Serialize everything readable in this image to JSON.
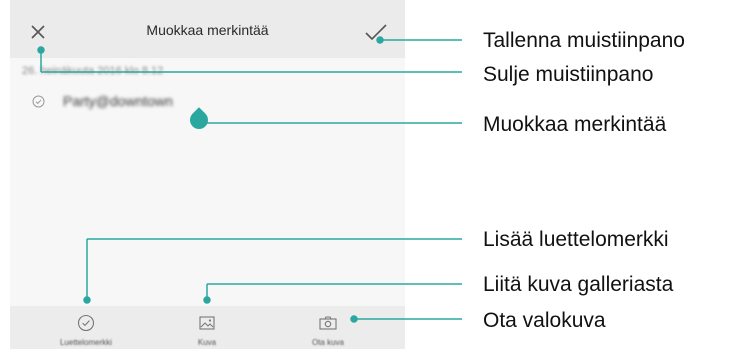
{
  "header": {
    "title": "Muokkaa merkintää",
    "close_icon": "close-icon",
    "save_icon": "checkmark-icon"
  },
  "note": {
    "date": "26. heinäkuuta 2016 klo 8.12",
    "text": "Party@downtown",
    "bullet_icon": "bullet-circle-icon"
  },
  "toolbar": {
    "items": [
      {
        "label": "Luettelomerkki",
        "icon": "bullet-list-icon"
      },
      {
        "label": "Kuva",
        "icon": "image-icon"
      },
      {
        "label": "Ota kuva",
        "icon": "camera-icon"
      }
    ]
  },
  "callouts": {
    "save": "Tallenna muistiinpano",
    "close": "Sulje muistiinpano",
    "edit": "Muokkaa merkintää",
    "bullet": "Lisää luettelomerkki",
    "gallery": "Liitä kuva galleriasta",
    "camera": "Ota valokuva"
  },
  "colors": {
    "accent": "#2aa89f",
    "topbar": "#ebebeb",
    "background": "#f7f7f7",
    "toolbar": "#ececec"
  }
}
